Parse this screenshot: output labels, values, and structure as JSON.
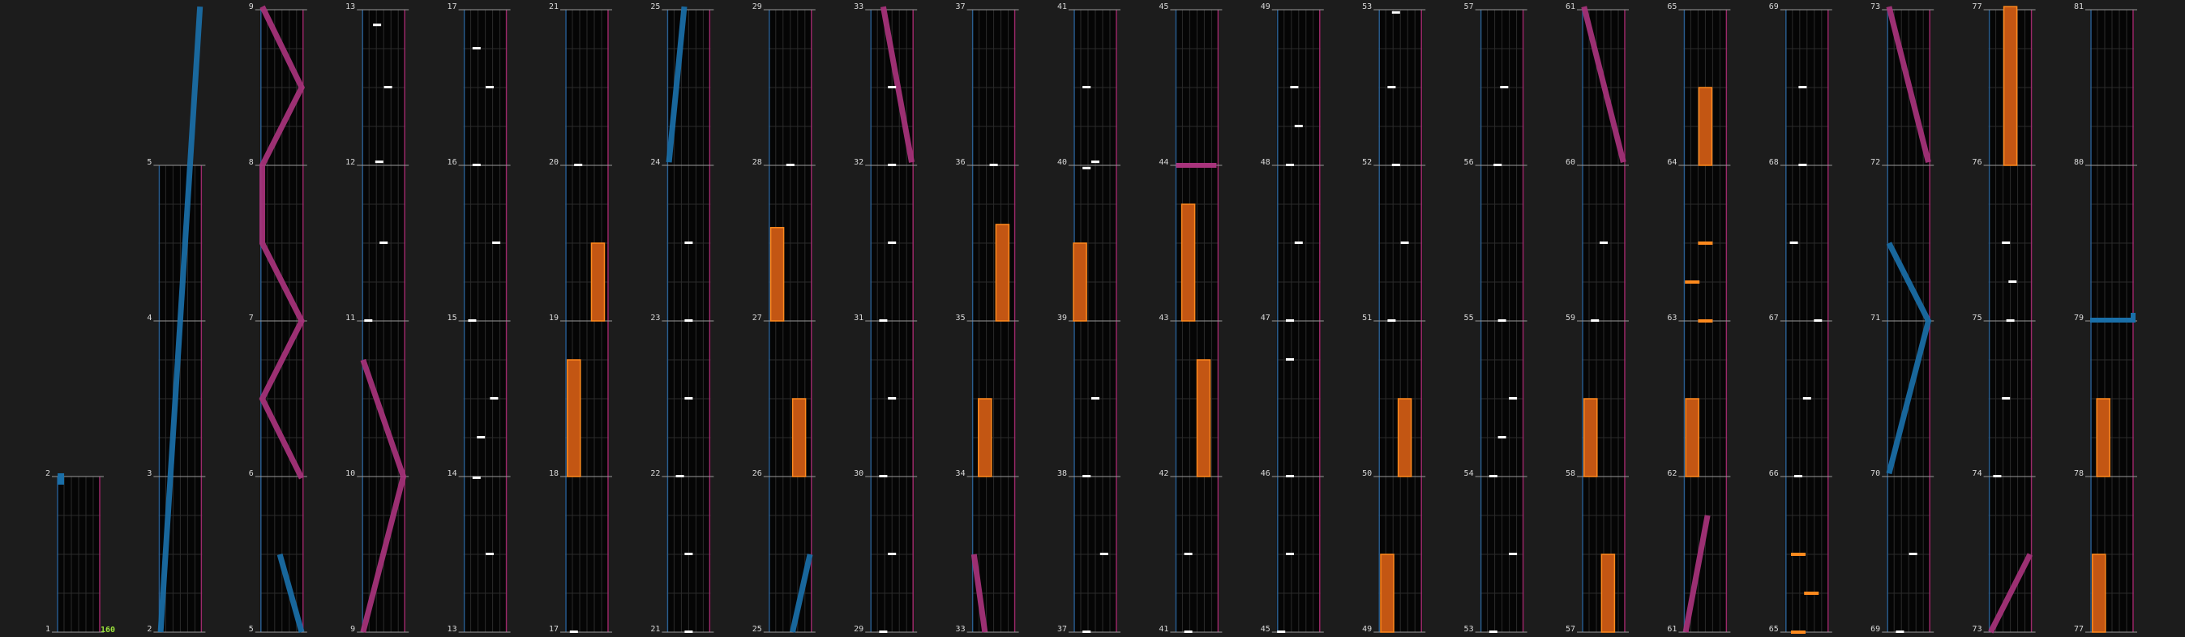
{
  "editor": {
    "bpm_label": "160",
    "colors": {
      "background": "#1c1c1c",
      "lane": "#050505",
      "grid": "#2b2b2b",
      "line_left": "#2a5d8e",
      "line_right": "#9b2a6a",
      "tap_note": "#ffffff",
      "hold_fill": "#c35613",
      "hold_edge": "#ff8a1e",
      "slide_left": "#1a6fa8",
      "slide_right": "#a8337c"
    },
    "columns": [
      {
        "measures": [
          {
            "label": "1"
          },
          {
            "label": "2"
          }
        ]
      },
      {
        "measures": [
          {
            "label": "2"
          },
          {
            "label": "3"
          },
          {
            "label": "4"
          },
          {
            "label": "5"
          }
        ]
      },
      {
        "measures": [
          {
            "label": "5"
          },
          {
            "label": "6"
          },
          {
            "label": "7"
          },
          {
            "label": "8"
          },
          {
            "label": "9"
          }
        ]
      },
      {
        "measures": [
          {
            "label": "9"
          },
          {
            "label": "10"
          },
          {
            "label": "11"
          },
          {
            "label": "12"
          },
          {
            "label": "13"
          }
        ]
      },
      {
        "measures": [
          {
            "label": "13"
          },
          {
            "label": "14"
          },
          {
            "label": "15"
          },
          {
            "label": "16"
          },
          {
            "label": "17"
          }
        ]
      },
      {
        "measures": [
          {
            "label": "17"
          },
          {
            "label": "18"
          },
          {
            "label": "19"
          },
          {
            "label": "20"
          },
          {
            "label": "21"
          }
        ]
      },
      {
        "measures": [
          {
            "label": "21"
          },
          {
            "label": "22"
          },
          {
            "label": "23"
          },
          {
            "label": "24"
          },
          {
            "label": "25"
          }
        ]
      },
      {
        "measures": [
          {
            "label": "25"
          },
          {
            "label": "26"
          },
          {
            "label": "27"
          },
          {
            "label": "28"
          },
          {
            "label": "29"
          }
        ]
      },
      {
        "measures": [
          {
            "label": "29"
          },
          {
            "label": "30"
          },
          {
            "label": "31"
          },
          {
            "label": "32"
          },
          {
            "label": "33"
          }
        ]
      },
      {
        "measures": [
          {
            "label": "33"
          },
          {
            "label": "34"
          },
          {
            "label": "35"
          },
          {
            "label": "36"
          },
          {
            "label": "37"
          }
        ]
      },
      {
        "measures": [
          {
            "label": "37"
          },
          {
            "label": "38"
          },
          {
            "label": "39"
          },
          {
            "label": "40"
          },
          {
            "label": "41"
          }
        ]
      },
      {
        "measures": [
          {
            "label": "41"
          },
          {
            "label": "42"
          },
          {
            "label": "43"
          },
          {
            "label": "44"
          },
          {
            "label": "45"
          }
        ]
      },
      {
        "measures": [
          {
            "label": "45"
          },
          {
            "label": "46"
          },
          {
            "label": "47"
          },
          {
            "label": "48"
          },
          {
            "label": "49"
          }
        ]
      },
      {
        "measures": [
          {
            "label": "49"
          },
          {
            "label": "50"
          },
          {
            "label": "51"
          },
          {
            "label": "52"
          },
          {
            "label": "53"
          }
        ]
      },
      {
        "measures": [
          {
            "label": "53"
          },
          {
            "label": "54"
          },
          {
            "label": "55"
          },
          {
            "label": "56"
          },
          {
            "label": "57"
          }
        ]
      },
      {
        "measures": [
          {
            "label": "57"
          },
          {
            "label": "58"
          },
          {
            "label": "59"
          },
          {
            "label": "60"
          },
          {
            "label": "61"
          }
        ]
      },
      {
        "measures": [
          {
            "label": "61"
          },
          {
            "label": "62"
          },
          {
            "label": "63"
          },
          {
            "label": "64"
          },
          {
            "label": "65"
          }
        ]
      },
      {
        "measures": [
          {
            "label": "65"
          },
          {
            "label": "66"
          },
          {
            "label": "67"
          },
          {
            "label": "68"
          },
          {
            "label": "69"
          }
        ]
      },
      {
        "measures": [
          {
            "label": "69"
          },
          {
            "label": "70"
          },
          {
            "label": "71"
          },
          {
            "label": "72"
          },
          {
            "label": "73"
          }
        ]
      },
      {
        "measures": [
          {
            "label": "73"
          },
          {
            "label": "74"
          },
          {
            "label": "75"
          },
          {
            "label": "76"
          },
          {
            "label": "77"
          }
        ]
      },
      {
        "measures": [
          {
            "label": "77"
          },
          {
            "label": "78"
          },
          {
            "label": "79"
          },
          {
            "label": "80"
          },
          {
            "label": "81"
          }
        ]
      }
    ]
  }
}
